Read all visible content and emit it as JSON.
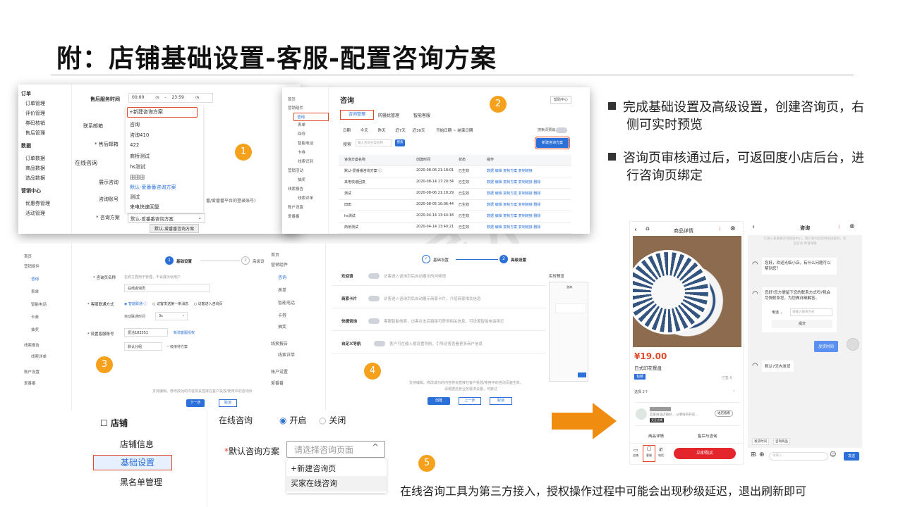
{
  "title": "附：店铺基础设置-客服-配置咨询方案",
  "watermark": "非会员水印",
  "badges": [
    "1",
    "2",
    "3",
    "4",
    "5"
  ],
  "bullets": [
    "完成基础设置及高级设置，创建咨询页，右侧可实时预览",
    "咨询页审核通过后，可返回度小店后台，进行咨询页绑定"
  ],
  "s1": {
    "sidebar": [
      "订单",
      "订单管理",
      "评价管理",
      "券码核销",
      "售后管理",
      "数据",
      "订单数据",
      "商品数据",
      "选品数据",
      "营销中心",
      "优惠券管理",
      "活动管理"
    ],
    "labels": [
      "售后服务时间",
      "联系邮箱",
      "* 售后邮箱",
      "在线咨询",
      "展示咨询",
      "咨询账号",
      "* 咨询方案"
    ],
    "time_from": "00:00",
    "time_to": "23:59",
    "dropdown": [
      "+新建咨询方案",
      "咨询",
      "咨询410",
      "422",
      "商桥测试",
      "hs测试",
      "田田田",
      "默认-爱番番咨询方案",
      "测试",
      "来电快速回复"
    ],
    "select_value": "默认-爱番番咨询方案",
    "tooltip": "默认-爱番番咨询方案",
    "hint": "番/爱番番平台的登录账号)"
  },
  "s2": {
    "side": [
      "首页",
      "营销组件",
      "咨询",
      "表单",
      "回呼",
      "智能电话",
      "卡券",
      "线索识别",
      "营销活动",
      "抽奖",
      "线索报告",
      "线索详单",
      "账户设置",
      "爱番番"
    ],
    "heading": "咨询",
    "help": "帮助中心",
    "tabs": [
      "咨询管理",
      "防骚扰管理",
      "智能客服"
    ],
    "dates": [
      "日期",
      "今天",
      "昨天",
      "近7天",
      "近30天",
      "开始日期 ~ 结束日期"
    ],
    "search_label": "搜索",
    "search_ph": "输入咨询方案名称",
    "search_btn": "搜索",
    "switch_label": "搜索词预输入",
    "new_btn": "新建咨询方案",
    "cols": [
      "咨询方案名称",
      "创建时间",
      "状态",
      "操作"
    ],
    "rows": [
      [
        "默认-爱番番咨询方案 ⓘ",
        "2020-08-06 21:18:01",
        "已生效",
        "数据 编辑 复制方案 复制链接"
      ],
      [
        "来电快速回复",
        "2020-08-14 17:20:34",
        "已生效",
        "数据 编辑 复制方案 复制链接 删除"
      ],
      [
        "测试",
        "2020-08-06 21:18:29",
        "已生效",
        "数据 编辑 复制方案 复制链接 删除"
      ],
      [
        "田田",
        "2020-08-05 10:06:44",
        "已生效",
        "数据 编辑 复制方案 复制链接 删除"
      ],
      [
        "hs测试",
        "2020-04-14 13:44:18",
        "已生效",
        "数据 编辑 复制方案 复制链接 删除"
      ],
      [
        "商桥测试",
        "2020-04-14 13:40:21",
        "已生效",
        "数据 编辑 复制方案 复制链接 删除"
      ]
    ]
  },
  "s3": {
    "side": [
      "首页",
      "营销组件",
      "咨询",
      "表单",
      "智能电话",
      "卡券",
      "抽奖",
      "线索报告",
      "线索详单",
      "账户设置",
      "爱番番"
    ],
    "step1": "基础设置",
    "step2": "高级设",
    "f_name": "* 咨询页名称",
    "f_name_hint": "名称主要用于管理，不会展示给用户",
    "f_name_val": "在线咨询页",
    "f_mode": "* 客服联通方式",
    "f_opts": [
      "智能联通 ⓘ",
      "访客发送第一条消息",
      "访客进入咨询页"
    ],
    "f_auto": "自动联通时间",
    "f_auto_val": "3s",
    "f_acct": "* 设置客服账号",
    "f_acct_val": "爱洽183351",
    "f_acct_link": "新增客服授权",
    "f_group": "默认分组",
    "f_group2": "一级接待方案",
    "footer": "支持编辑。修改成功的内容将会直接在客户投放/使用中的咨询页",
    "next": "下一步",
    "cancel": "取消"
  },
  "s4": {
    "side": [
      "首页",
      "营销组件",
      "咨询",
      "表单",
      "智能电话",
      "卡券",
      "抽奖",
      "线索报告",
      "线索详单",
      "账户设置",
      "爱番番"
    ],
    "step1": "基础设置",
    "step2": "高级设置",
    "preview": "实时预览",
    "preview_title": "咨询",
    "items": [
      [
        "欢迎语",
        "访客进入咨询页后自动展示的问候语"
      ],
      [
        "商家卡片",
        "访客进入咨询页后自动展示商家卡片，介绍商家相关信息"
      ],
      [
        "快捷咨询",
        "客服智能线索，访客点击后链接可获得相关信息，可设置智能电话拨打"
      ],
      [
        "自定义导航",
        "客户可在输入框设置导航，引导访客查看更多商户信息"
      ]
    ],
    "footer1": "支持编辑。修改成功的内容将会直接在客户投放/使用中的咨询页面生效。",
    "footer2": "请根据自身业务需求设置，可跳过",
    "create": "创建",
    "prev": "上一步",
    "cancel": "取消"
  },
  "s5": {
    "store": "店铺",
    "items": [
      "店铺信息",
      "基础设置",
      "黑名单管理"
    ],
    "online_label": "在线咨询",
    "on": "开启",
    "off": "关闭",
    "default_label": "默认咨询方案",
    "placeholder": "请选择咨询页面",
    "options": [
      "+新建咨询页",
      "买家在线咨询"
    ]
  },
  "note": "在线咨询工具为第三方接入，授权操作过程中可能会出现秒级延迟，退出刷新即可",
  "phone1": {
    "title": "商品详情",
    "price": "¥19.00",
    "product": "日式印花餐盘",
    "tag": "包邮",
    "sold": "已售 0",
    "select": "选择  2个",
    "shop_desc": "宜家商品店铺好... 从更好的开店...",
    "follow": "进店看看",
    "shop_badge": "关注店铺",
    "tabs": [
      "商品详情",
      "售后与咨询"
    ],
    "icons": [
      "店铺",
      "客服",
      "电话"
    ],
    "buy": "立即购买"
  },
  "phone2": {
    "title": "咨询",
    "notice": "已进入爱番番咨询频道中心，我们将为您提供优质服务，欢迎咨询 申请保障",
    "msg1": "您好，欢迎光临小店，有什么问题可以帮到您？",
    "msg2": "您好!您方便留下您的联系方式吗?我会尽快联系您，为您做详细解答。",
    "contact_type": "电话",
    "contact_ph": "请输入联系方式",
    "submit": "提交",
    "user_msg": "发货时间",
    "msg3": "默认7天内发货",
    "chips": [
      "发货时间",
      "咨询商品"
    ],
    "input_ph": "请输入...",
    "send": "发送"
  }
}
